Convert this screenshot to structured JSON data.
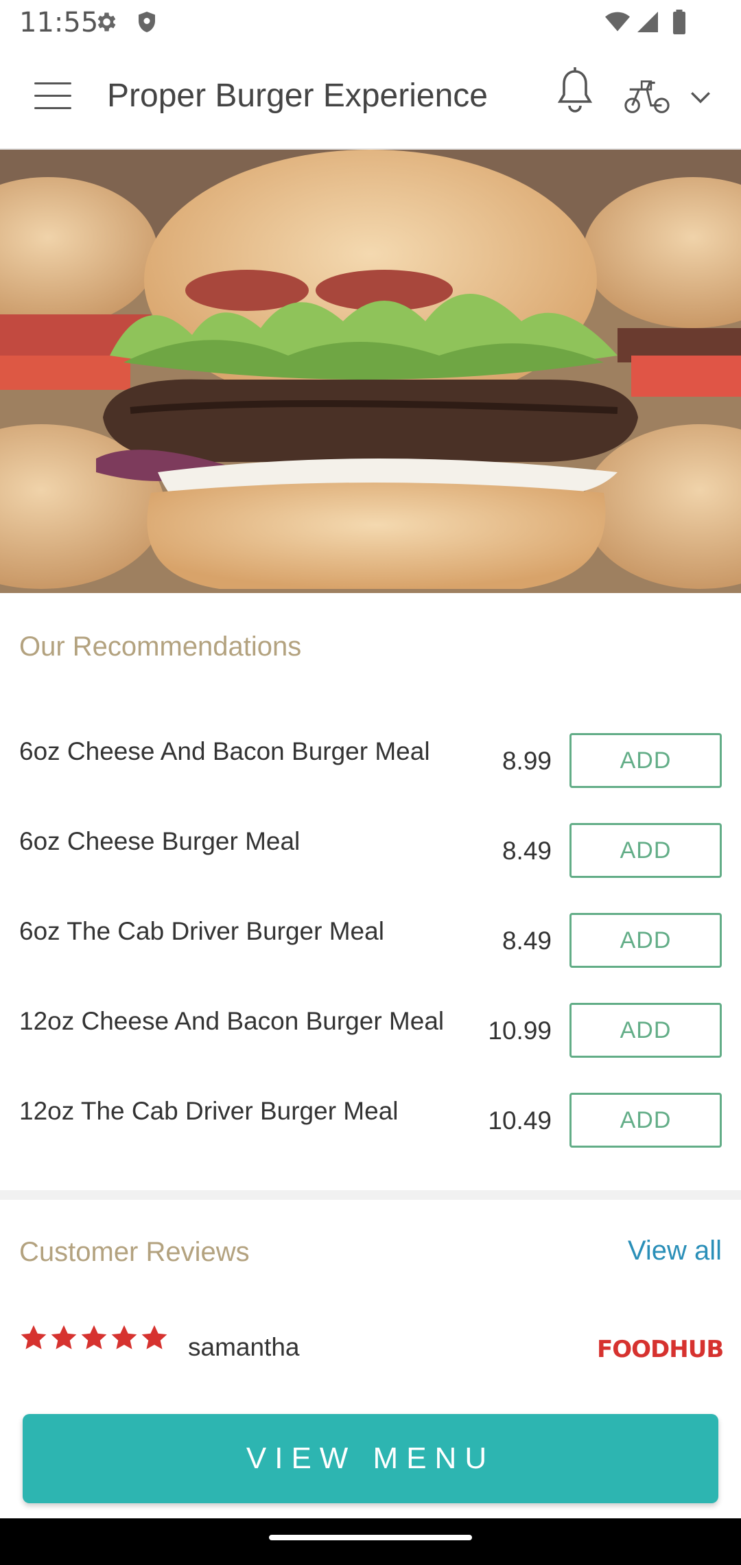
{
  "status_bar": {
    "time": "11:55",
    "icons": [
      "settings-icon",
      "shield-icon",
      "wifi-icon",
      "signal-icon",
      "battery-icon"
    ]
  },
  "app_bar": {
    "title": "Proper Burger Experience",
    "icons": [
      "hamburger-menu-icon",
      "bell-icon",
      "delivery-scooter-icon",
      "chevron-down-icon"
    ]
  },
  "hero": {
    "image": "burger-hero-image"
  },
  "recommendations": {
    "title": "Our Recommendations",
    "add_label": "ADD",
    "items": [
      {
        "name": "6oz Cheese And Bacon Burger Meal",
        "price": "8.99"
      },
      {
        "name": "6oz Cheese Burger Meal",
        "price": "8.49"
      },
      {
        "name": "6oz The Cab Driver Burger Meal",
        "price": "8.49"
      },
      {
        "name": "12oz Cheese And Bacon Burger Meal",
        "price": "10.99"
      },
      {
        "name": "12oz The Cab Driver Burger Meal",
        "price": "10.49"
      }
    ]
  },
  "reviews": {
    "title": "Customer Reviews",
    "view_all": "View all",
    "items": [
      {
        "reviewer": "samantha",
        "rating": 5,
        "source": "FOODHUB"
      }
    ]
  },
  "cta": {
    "label": "VIEW MENU"
  },
  "colors": {
    "accent_teal": "#2db5b1",
    "add_green": "#62ad87",
    "section_tan": "#b3a27f",
    "link_blue": "#2a8fb8",
    "star_red": "#d6322f"
  }
}
